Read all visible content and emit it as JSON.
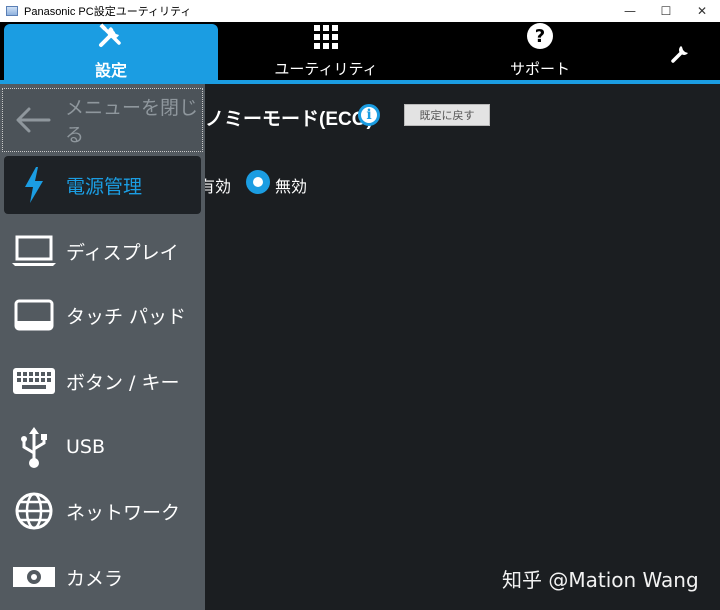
{
  "window": {
    "title": "Panasonic PC設定ユーティリティ",
    "minimize": "—",
    "maximize": "☐",
    "close": "✕"
  },
  "tabs": [
    {
      "label": "設定",
      "icon": "tools-icon",
      "active": true
    },
    {
      "label": "ユーティリティ",
      "icon": "grid-icon",
      "active": false
    },
    {
      "label": "サポート",
      "icon": "question-icon",
      "active": false
    }
  ],
  "sidebar": {
    "close_label": "メニューを閉じる",
    "items": [
      {
        "label": "電源管理",
        "icon": "lightning-icon",
        "active": true
      },
      {
        "label": "ディスプレイ",
        "icon": "laptop-icon",
        "active": false
      },
      {
        "label": "タッチ パッド",
        "icon": "touchpad-icon",
        "active": false
      },
      {
        "label": "ボタン / キー",
        "icon": "keyboard-icon",
        "active": false
      },
      {
        "label": "USB",
        "icon": "usb-icon",
        "active": false
      },
      {
        "label": "ネットワーク",
        "icon": "globe-icon",
        "active": false
      },
      {
        "label": "カメラ",
        "icon": "camera-icon",
        "active": false
      }
    ]
  },
  "content": {
    "setting_title": "ノミーモード(ECO)",
    "reset_label": "既定に戻す",
    "option_enabled": "有効",
    "option_disabled": "無効",
    "selected": "無効"
  },
  "watermark": "知乎 @Mation Wang",
  "colors": {
    "accent": "#1b9de2",
    "sidebar": "#535a60",
    "background": "#1b1e21",
    "topbar": "#000000"
  }
}
